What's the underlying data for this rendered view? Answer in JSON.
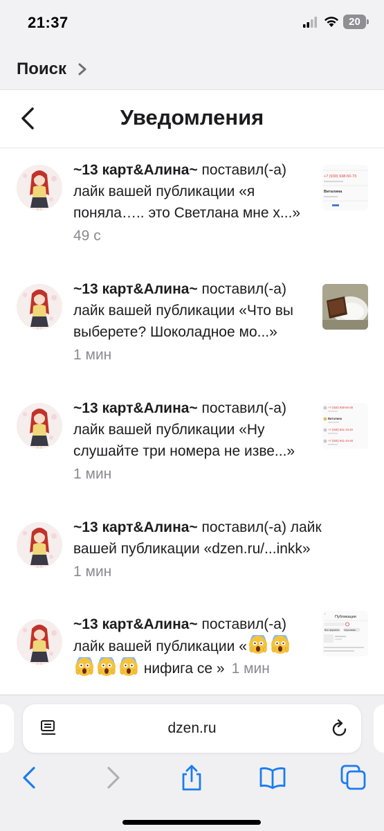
{
  "status_bar": {
    "time": "21:37",
    "battery": "20"
  },
  "search_back": {
    "label": "Поиск"
  },
  "header": {
    "title": "Уведомления"
  },
  "notifications": [
    {
      "author": "~13 карт&Алина~",
      "text": " поставил(-а) лайк вашей публикации «я поняла….. это Светлана мне х...»",
      "time": "49 с"
    },
    {
      "author": "~13 карт&Алина~",
      "text": " поставил(-а) лайк вашей публикации «Что вы выберете? Шоколадное мо...»",
      "time": "1 мин"
    },
    {
      "author": "~13 карт&Алина~",
      "text": " поставил(-а) лайк вашей публикации «Ну слушайте три номера не изве...»",
      "time": "1 мин"
    },
    {
      "author": "~13 карт&Алина~",
      "text": " поставил(-а) лайк вашей публикации «dzen.ru/...inkk»",
      "time": "1 мин"
    },
    {
      "author": "~13 карт&Алина~",
      "text_before": " поставил(-а) лайк вашей публикации «",
      "text_after": " нифига се »",
      "time": "1 мин"
    }
  ],
  "thumbnails": {
    "t1": {
      "phone": "+7 (930) 938-50-73",
      "name": "Виталина"
    },
    "t3": {
      "row1": "+7 (930) 938-50-38",
      "row2": "Виталина",
      "row3": "+7 (930) 941-10-40",
      "row4": "+7 (930) 941-10-48"
    },
    "t5": {
      "title": "Публикации",
      "tab": "Все форматы",
      "chip": "Черновики"
    }
  },
  "address_bar": {
    "url": "dzen.ru"
  },
  "colors": {
    "accent": "#1a7cf0",
    "time_text": "#8a8a8e",
    "toolbar_disabled": "#b0b0b4"
  },
  "icons": [
    "signal-icon",
    "wifi-icon",
    "battery-icon",
    "chevron-right-icon",
    "back-arrow-icon",
    "reader-icon",
    "reload-icon",
    "back-icon",
    "forward-icon",
    "share-icon",
    "bookmarks-icon",
    "tabs-icon",
    "screaming-face-emoji"
  ]
}
